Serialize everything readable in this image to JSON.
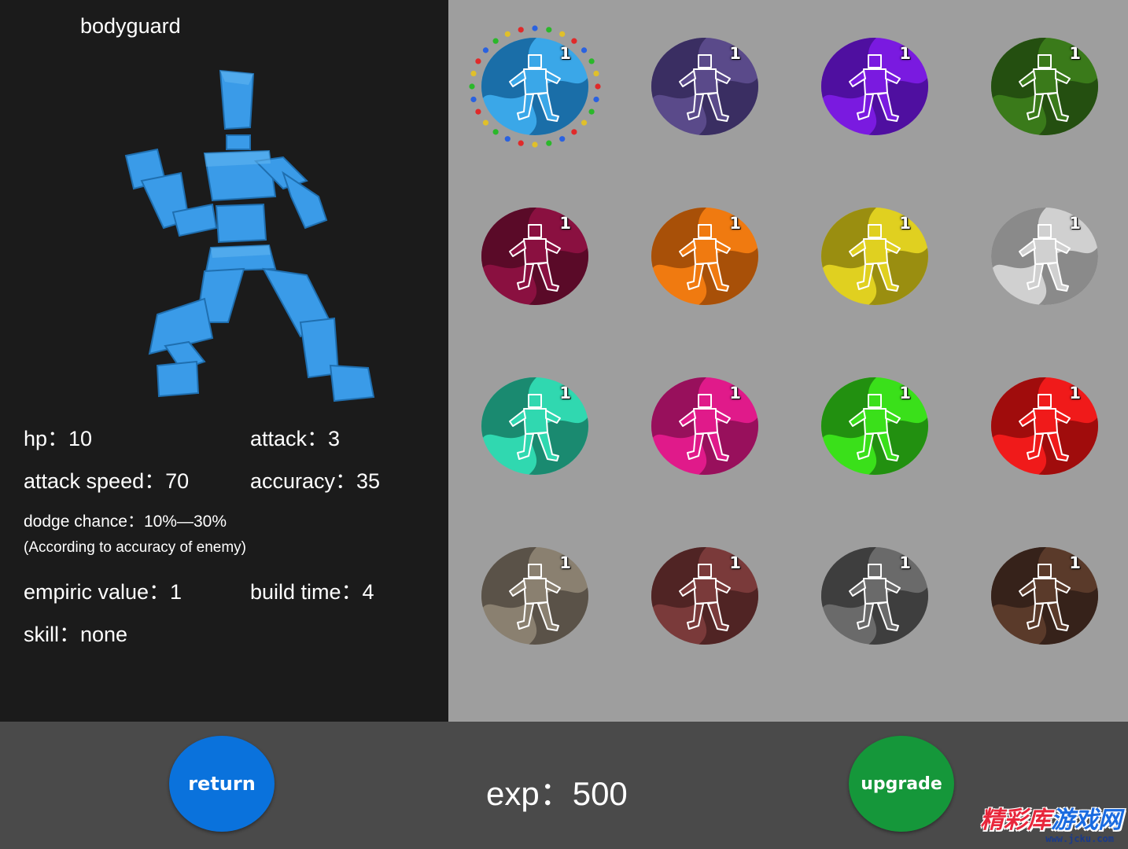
{
  "unit": {
    "name": "bodyguard",
    "stats": {
      "hp": "hp：10",
      "attack": "attack：3",
      "attack_speed": "attack speed：70",
      "accuracy": "accuracy：35",
      "dodge": "dodge chance：10%—30%",
      "dodge_note": "(According to accuracy of enemy)",
      "empiric_value": "empiric value：1",
      "build_time": "build time：4",
      "skill": "skill：none"
    },
    "color": "#3a9be8"
  },
  "grid": {
    "units": [
      {
        "id": "bodyguard",
        "level": "1",
        "color": "#3aa7e8",
        "dark": "#1a6ea8",
        "figure": "fighter-icon",
        "selected": true
      },
      {
        "id": "spearman",
        "level": "1",
        "color": "#5a4a8a",
        "dark": "#3a2e62",
        "figure": "spearman-icon"
      },
      {
        "id": "brute",
        "level": "1",
        "color": "#7a1ae0",
        "dark": "#4f0fa0",
        "figure": "brute-icon"
      },
      {
        "id": "archer",
        "level": "1",
        "color": "#3a7a1a",
        "dark": "#244f10",
        "figure": "archer-icon"
      },
      {
        "id": "crossbowman",
        "level": "1",
        "color": "#8a1040",
        "dark": "#5a0a28",
        "figure": "crossbow-icon"
      },
      {
        "id": "boxer",
        "level": "1",
        "color": "#f07a10",
        "dark": "#a85008",
        "figure": "boxer-icon"
      },
      {
        "id": "swordsman",
        "level": "1",
        "color": "#e0d020",
        "dark": "#9a8e10",
        "figure": "greatsword-icon"
      },
      {
        "id": "mage",
        "level": "1",
        "color": "#d0d0d0",
        "dark": "#8a8a8a",
        "figure": "mage-icon"
      },
      {
        "id": "dancer",
        "level": "1",
        "color": "#30d8b0",
        "dark": "#1a8a70",
        "figure": "dancer-icon"
      },
      {
        "id": "kicker",
        "level": "1",
        "color": "#e01a8a",
        "dark": "#98105c",
        "figure": "kicker-icon"
      },
      {
        "id": "puncher",
        "level": "1",
        "color": "#3ae01a",
        "dark": "#229010",
        "figure": "puncher-icon"
      },
      {
        "id": "berserker",
        "level": "1",
        "color": "#f01a1a",
        "dark": "#a00c0c",
        "figure": "berserker-icon"
      },
      {
        "id": "ranger",
        "level": "1",
        "color": "#8a8070",
        "dark": "#5a5248",
        "figure": "bow-icon"
      },
      {
        "id": "dualblade",
        "level": "1",
        "color": "#7a3a3a",
        "dark": "#502424",
        "figure": "dual-blade-icon"
      },
      {
        "id": "knight",
        "level": "1",
        "color": "#6a6a6a",
        "dark": "#3e3e3e",
        "figure": "shield-knight-icon"
      },
      {
        "id": "hammerer",
        "level": "1",
        "color": "#5a3a2a",
        "dark": "#36221a",
        "figure": "hammer-icon"
      }
    ]
  },
  "footer": {
    "return_label": "return",
    "upgrade_label": "upgrade",
    "exp_text": "exp：500"
  },
  "watermark": {
    "cn_red": "精彩库",
    "cn_blue": "游戏网",
    "url": "www.jcku.com"
  }
}
